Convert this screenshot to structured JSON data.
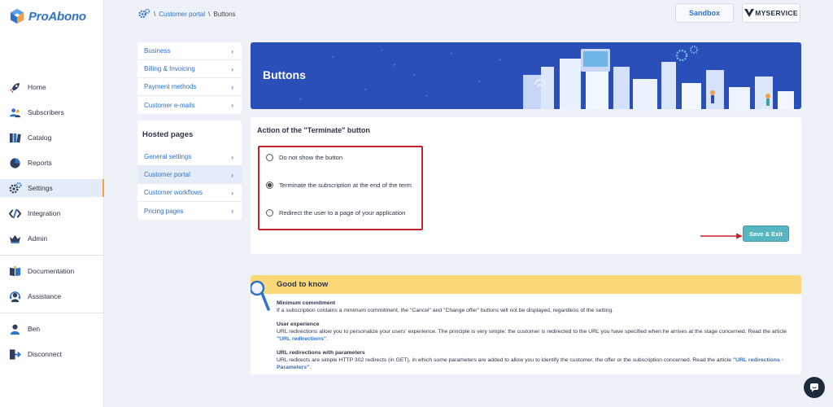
{
  "app": {
    "name": "ProAbono"
  },
  "sidebar": {
    "items": [
      {
        "label": "Home",
        "icon": "rocket-icon"
      },
      {
        "label": "Subscribers",
        "icon": "subscribers-icon"
      },
      {
        "label": "Catalog",
        "icon": "catalog-icon"
      },
      {
        "label": "Reports",
        "icon": "reports-icon"
      },
      {
        "label": "Settings",
        "icon": "gear-icon",
        "active": true
      },
      {
        "label": "Integration",
        "icon": "code-icon"
      },
      {
        "label": "Admin",
        "icon": "crown-icon"
      }
    ],
    "support": [
      {
        "label": "Documentation",
        "icon": "book-icon"
      },
      {
        "label": "Assistance",
        "icon": "headset-icon"
      }
    ],
    "account": [
      {
        "label": "Ben",
        "icon": "user-icon"
      },
      {
        "label": "Disconnect",
        "icon": "logout-icon"
      }
    ]
  },
  "breadcrumb": {
    "sep": "\\",
    "parent": "Customer portal",
    "current": "Buttons"
  },
  "header": {
    "sandbox_label": "Sandbox",
    "brand_label": "MYSERVICE"
  },
  "settings_menu": {
    "top_items": [
      "Business",
      "Billing & Invoicing",
      "Payment methods",
      "Customer e-mails"
    ],
    "hosted_heading": "Hosted pages",
    "hosted_items": [
      "General settings",
      "Customer portal",
      "Customer workflows",
      "Pricing pages"
    ],
    "active_item": "Customer portal"
  },
  "banner": {
    "title": "Buttons"
  },
  "terminate": {
    "title": "Action of the \"Terminate\" button",
    "options": [
      {
        "label": "Do not show the button",
        "checked": false
      },
      {
        "label": "Terminate the subscription at the end of the term",
        "checked": true
      },
      {
        "label": "Redirect the user to a page of your application",
        "checked": false
      }
    ],
    "save_label": "Save & Exit"
  },
  "good_to_know": {
    "title": "Good to know",
    "sections": [
      {
        "heading": "Minimum commitment",
        "text": "If a subscription contains a minimum commitment, the \"Cancel\" and \"Change offer\" buttons will not be displayed, regardless of the setting."
      },
      {
        "heading": "User experience",
        "text": "URL redirections allow you to personalize your users' experience. The principle is very simple: the customer is redirected to the URL you have specified when he arrives at the stage concerned. Read the article ",
        "link": "\"URL redirections\"",
        "after": "."
      },
      {
        "heading": "URL redirections with parameters",
        "text": "URL redirects are simple HTTP 302 redirects (in GET), in which some parameters are added to allow you to identify the customer, the offer or the subscription concerned. Read the article ",
        "link": "\"URL redirections - Parameters\"",
        "after": "."
      }
    ]
  },
  "colors": {
    "accent": "#2f73c9",
    "banner": "#2a4fb8",
    "save": "#56b6c2",
    "highlight": "#c0232b",
    "notice": "#fcd978"
  }
}
